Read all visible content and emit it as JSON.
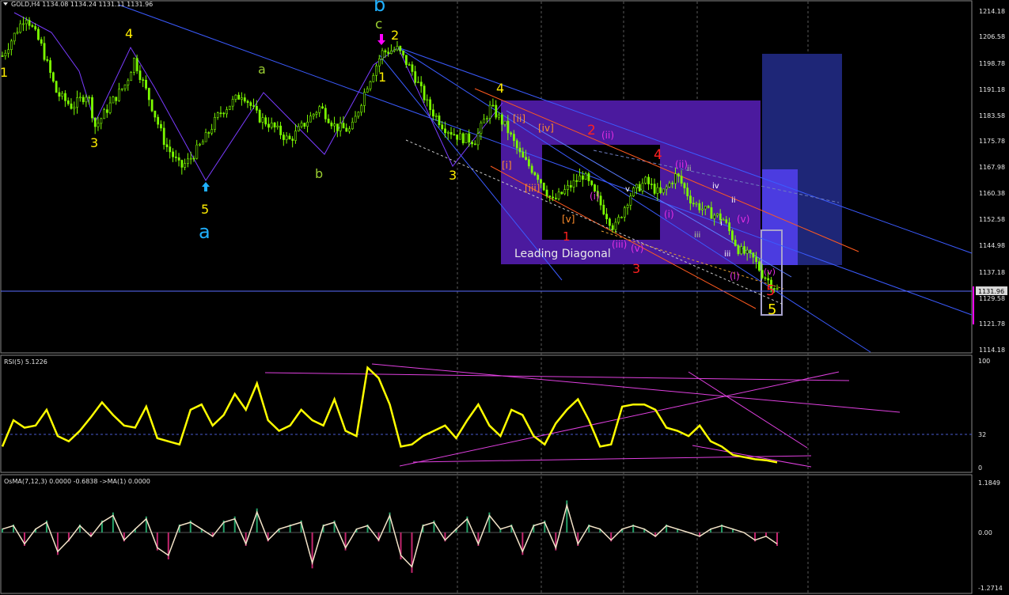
{
  "header": {
    "main": "GOLD,H4  1134.08 1134.24 1131.11 1131.96",
    "rsi": "RSI(5) 5.1226",
    "osma": "OsMA(7,12,3) 0.0000 -0.6838  ->MA(1) 0.0000"
  },
  "price_axis": [
    "1214.18",
    "1206.58",
    "1198.78",
    "1191.18",
    "1183.58",
    "1175.78",
    "1167.98",
    "1160.38",
    "1152.58",
    "1144.98",
    "1137.18",
    "1129.58",
    "1121.78",
    "1114.18"
  ],
  "current_price": "1131.96",
  "rsi_axis": [
    "100",
    "32",
    "0"
  ],
  "osma_axis": [
    "1.1849",
    "0.00",
    "-1.2714"
  ],
  "chart_data": [
    {
      "type": "candlestick",
      "symbol": "GOLD",
      "timeframe": "H4",
      "ylim": [
        1114.18,
        1214.18
      ],
      "last": {
        "open": 1134.08,
        "high": 1134.24,
        "low": 1131.11,
        "close": 1131.96
      },
      "price_path": [
        [
          0,
          1201
        ],
        [
          0.02,
          1209
        ],
        [
          0.03,
          1213
        ],
        [
          0.05,
          1204
        ],
        [
          0.07,
          1190
        ],
        [
          0.09,
          1186
        ],
        [
          0.11,
          1190
        ],
        [
          0.12,
          1180
        ],
        [
          0.14,
          1187
        ],
        [
          0.16,
          1193
        ],
        [
          0.17,
          1200
        ],
        [
          0.19,
          1188
        ],
        [
          0.21,
          1175
        ],
        [
          0.23,
          1168
        ],
        [
          0.24,
          1170
        ],
        [
          0.26,
          1176
        ],
        [
          0.28,
          1184
        ],
        [
          0.31,
          1190
        ],
        [
          0.33,
          1183
        ],
        [
          0.35,
          1180
        ],
        [
          0.37,
          1176
        ],
        [
          0.39,
          1181
        ],
        [
          0.41,
          1186
        ],
        [
          0.43,
          1180
        ],
        [
          0.45,
          1179
        ],
        [
          0.47,
          1192
        ],
        [
          0.49,
          1202
        ],
        [
          0.51,
          1203
        ],
        [
          0.53,
          1196
        ],
        [
          0.55,
          1186
        ],
        [
          0.57,
          1180
        ],
        [
          0.59,
          1177
        ],
        [
          0.61,
          1176
        ],
        [
          0.63,
          1186
        ],
        [
          0.65,
          1180
        ],
        [
          0.67,
          1171
        ],
        [
          0.69,
          1166
        ],
        [
          0.71,
          1158
        ],
        [
          0.73,
          1162
        ],
        [
          0.75,
          1166
        ],
        [
          0.77,
          1158
        ],
        [
          0.79,
          1150
        ],
        [
          0.81,
          1160
        ],
        [
          0.83,
          1164
        ],
        [
          0.85,
          1160
        ],
        [
          0.87,
          1166
        ],
        [
          0.89,
          1158
        ],
        [
          0.91,
          1155
        ],
        [
          0.93,
          1153
        ],
        [
          0.95,
          1144
        ],
        [
          0.97,
          1141
        ],
        [
          0.98,
          1137
        ],
        [
          1.0,
          1132
        ]
      ]
    },
    {
      "type": "line",
      "name": "RSI(5)",
      "ylim": [
        0,
        100
      ],
      "level": 32,
      "values": [
        20,
        45,
        38,
        40,
        55,
        30,
        25,
        35,
        48,
        62,
        50,
        40,
        38,
        58,
        28,
        25,
        22,
        55,
        60,
        40,
        50,
        70,
        55,
        80,
        45,
        35,
        40,
        55,
        45,
        40,
        65,
        35,
        30,
        95,
        85,
        60,
        20,
        22,
        30,
        35,
        40,
        28,
        45,
        60,
        40,
        30,
        55,
        50,
        30,
        22,
        42,
        55,
        65,
        45,
        20,
        22,
        58,
        60,
        60,
        55,
        38,
        35,
        30,
        40,
        25,
        20,
        12,
        10,
        8,
        7,
        5
      ]
    },
    {
      "type": "bar",
      "name": "OsMA(7,12,3)",
      "ylim": [
        -1.2714,
        1.1849
      ],
      "values": [
        0.1,
        0.2,
        -0.3,
        0.1,
        0.3,
        -0.5,
        -0.2,
        0.2,
        -0.1,
        0.3,
        0.5,
        -0.2,
        0.1,
        0.4,
        -0.4,
        -0.6,
        0.2,
        0.3,
        0.1,
        -0.1,
        0.3,
        0.4,
        -0.3,
        0.6,
        -0.2,
        0.1,
        0.2,
        0.3,
        -0.8,
        0.2,
        0.3,
        -0.4,
        0.1,
        0.2,
        -0.2,
        0.5,
        -0.6,
        -0.9,
        0.2,
        0.3,
        -0.2,
        0.1,
        0.4,
        -0.3,
        0.5,
        0.1,
        0.2,
        -0.5,
        0.2,
        0.3,
        -0.4,
        0.8,
        -0.3,
        0.2,
        0.1,
        -0.2,
        0.1,
        0.2,
        0.1,
        -0.1,
        0.2,
        0.1,
        0.0,
        -0.1,
        0.1,
        0.2,
        0.1,
        0.0,
        -0.2,
        -0.1,
        -0.3
      ]
    }
  ],
  "annotations": {
    "yellow": [
      "1",
      "4",
      "3",
      "5",
      "4",
      "3",
      "1",
      "2",
      "4",
      "5"
    ],
    "green": [
      "a",
      "b",
      "c"
    ],
    "cyan": [
      "a",
      "b"
    ],
    "red": [
      "2",
      "4",
      "1",
      "3",
      "5"
    ],
    "orange": [
      "[ii]",
      "[iv]",
      "[i]",
      "[iii]",
      "[v]"
    ],
    "magenta": [
      "(ii)",
      "(i)",
      "(iii)",
      "(v)",
      "(i)",
      "(ii)",
      "(iv)",
      "(v)",
      "(iii)",
      "(ii)",
      "(i)"
    ],
    "roman": [
      "v",
      "iii",
      "ii",
      "iv",
      "ii",
      "iii",
      "i",
      "iii",
      "v",
      "ii",
      "i"
    ],
    "box_label": "Leading Diagonal"
  },
  "colors": {
    "bg": "#000000",
    "candle": "#7CFC00",
    "rsi": "#ffff00",
    "osma_pos": "#26a269",
    "osma_neg": "#c3266e",
    "grid": "#606060",
    "trend_blue": "#3b5bff",
    "trend_orange": "#ff5a1f",
    "purple_box": "#4b1a9e",
    "navy_box": "#1e2677",
    "price_line": "#5a6bff",
    "magenta": "#ff00ff"
  }
}
